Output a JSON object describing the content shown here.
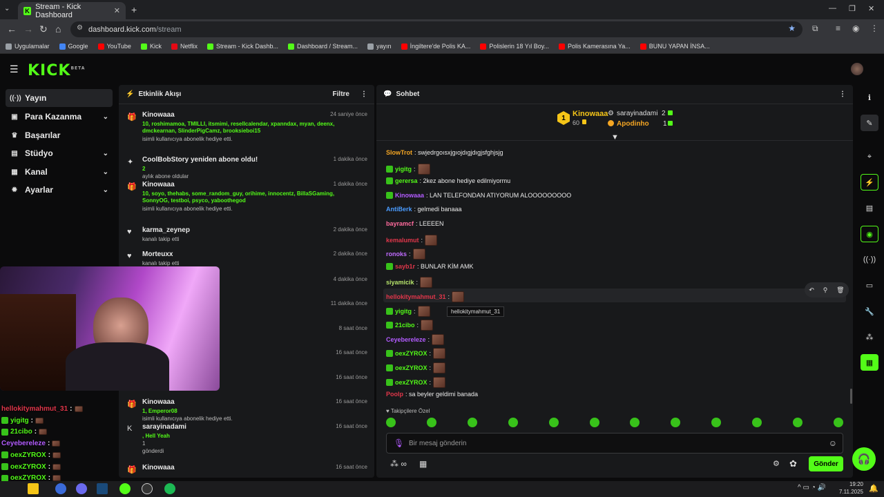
{
  "browser": {
    "tab_title": "Stream - Kick Dashboard",
    "url_host": "dashboard.kick.com",
    "url_path": "/stream",
    "bookmarks": [
      {
        "label": "Uygulamalar",
        "color": "#9aa0a6"
      },
      {
        "label": "Google",
        "color": "#4285f4"
      },
      {
        "label": "YouTube",
        "color": "#ff0000"
      },
      {
        "label": "Kick",
        "color": "#53fc18"
      },
      {
        "label": "Netflix",
        "color": "#e50914"
      },
      {
        "label": "Stream - Kick Dashb...",
        "color": "#53fc18"
      },
      {
        "label": "Dashboard / Stream...",
        "color": "#53fc18"
      },
      {
        "label": "yayın",
        "color": "#9aa0a6"
      },
      {
        "label": "İngiltere'de Polis KA...",
        "color": "#ff0000"
      },
      {
        "label": "Polislerin 18 Yıl Boy...",
        "color": "#ff0000"
      },
      {
        "label": "Polis Kamerasına Ya...",
        "color": "#ff0000"
      },
      {
        "label": "BUNU YAPAN İNSA...",
        "color": "#ff0000"
      }
    ]
  },
  "app": {
    "logo": "KICK",
    "logo_badge": "BETA",
    "accent": "#53fc18"
  },
  "nav": {
    "items": [
      {
        "label": "Yayın",
        "icon": "broadcast-icon",
        "glyph": "((·))"
      },
      {
        "label": "Para Kazanma",
        "icon": "money-icon",
        "glyph": "▣"
      },
      {
        "label": "Başarılar",
        "icon": "trophy-icon",
        "glyph": "♛"
      },
      {
        "label": "Stüdyo",
        "icon": "studio-icon",
        "glyph": "▤"
      },
      {
        "label": "Kanal",
        "icon": "channel-icon",
        "glyph": "▦"
      },
      {
        "label": "Ayarlar",
        "icon": "settings-icon",
        "glyph": "✹"
      }
    ]
  },
  "activity": {
    "title": "Etkinlik Akışı",
    "filter_label": "Filtre",
    "events": [
      {
        "who": "Kinowaaa",
        "when": "24 saniye önce",
        "line2": "10, roshimamoa, TMILLI, itsmimi, resellcalendar, xpanndax, myan, deenx, dmckearnan, SlinderPigCamz, brooksieboi15",
        "line3": "isimli kullanıcıya abonelik hediye etti.",
        "icon": "gift-icon",
        "glyph": "🎁"
      },
      {
        "who": "CoolBobStory yeniden abone oldu!",
        "when": "1 dakika önce",
        "line2": "2",
        "line3": "aylık abone oldular",
        "icon": "star-icon",
        "glyph": "✦"
      },
      {
        "who": "Kinowaaa",
        "when": "1 dakika önce",
        "line2": "10, soyo, thehabs, some_random_guy, orihime, innocentz, BillaSGaming, SonnyOG, testboi, psyco, yaboothegod",
        "line3": "isimli kullanıcıya abonelik hediye etti.",
        "icon": "gift-icon",
        "glyph": "🎁"
      },
      {
        "who": "karma_zeynep",
        "when": "2 dakika önce",
        "line2": "",
        "line3": "kanalı takip etti",
        "icon": "heart-icon",
        "glyph": "♥"
      },
      {
        "who": "Morteuxx",
        "when": "2 dakika önce",
        "line2": "",
        "line3": "kanalı takip etti",
        "icon": "heart-icon",
        "glyph": "♥"
      }
    ],
    "hidden_times": [
      "4 dakika önce",
      "11 dakika önce",
      "8 saat önce",
      "16 saat önce",
      "16 saat önce"
    ],
    "bottom_events": [
      {
        "who": "Kinowaaa",
        "when": "16 saat önce",
        "line2": "1, Emperor08",
        "line3": "isimli kullanıcıya abonelik hediye etti.",
        "icon": "gift-icon",
        "glyph": "🎁"
      },
      {
        "who": "sarayinadami",
        "when": "16 saat önce",
        "line2": ", Hell Yeah",
        "line3": "1",
        "line4": "gönderdi",
        "icon": "kick-icon",
        "glyph": "K"
      },
      {
        "who": "Kinowaaa",
        "when": "16 saat önce",
        "line2": "",
        "line3": "",
        "icon": "gift-icon",
        "glyph": "🎁"
      }
    ]
  },
  "chat": {
    "title": "Sohbet",
    "leaderboard": {
      "first_name": "Kinowaaa",
      "first_count": "60",
      "first_rank": "1",
      "second_name": "sarayinadami",
      "second_count": "2",
      "third_name": "Apodinho",
      "third_count": "1"
    },
    "messages": [
      {
        "user": "SlowTrot",
        "color": "#f5a623",
        "text": ": swjedrgoısxjgıojdıgjdıgjsfghjsjg",
        "emote": false
      },
      {
        "user": "yigitg",
        "color": "#53fc18",
        "text": ":",
        "emote": true
      },
      {
        "user": "gerersa",
        "color": "#53fc18",
        "text": ": 2kez abone hediye edilmiyormu",
        "emote": false
      },
      {
        "user": "Kinowaaa",
        "color": "#b35cff",
        "text": ": LAN TELEFONDAN ATIYORUM ALOOOOOOOOO",
        "emote": false
      },
      {
        "user": "AntiBerk",
        "color": "#4a9cff",
        "text": ": gelmedi banaaa",
        "emote": false
      },
      {
        "user": "bayramcf",
        "color": "#ff6b9d",
        "text": ": LEEEEN",
        "emote": false
      },
      {
        "user": "kemalumut",
        "color": "#e0364a",
        "text": ":",
        "emote": true
      },
      {
        "user": "ronoks",
        "color": "#c06bff",
        "text": ":",
        "emote": true
      },
      {
        "user": "sayb1r",
        "color": "#e0364a",
        "text": ": BUNLAR KİM AMK",
        "emote": false
      },
      {
        "user": "siyamicik",
        "color": "#b6e36b",
        "text": ":",
        "emote": true
      },
      {
        "user": "hellokitymahmut_31",
        "color": "#e0364a",
        "text": ":",
        "emote": true
      },
      {
        "user": "yigitg",
        "color": "#53fc18",
        "text": ":",
        "emote": true
      },
      {
        "user": "21cibo",
        "color": "#53fc18",
        "text": ":",
        "emote": true
      },
      {
        "user": "Ceyebereleze",
        "color": "#b35cff",
        "text": ":",
        "emote": true
      },
      {
        "user": "oexZYROX",
        "color": "#53fc18",
        "text": ":",
        "emote": true
      },
      {
        "user": "oexZYROX",
        "color": "#53fc18",
        "text": ":",
        "emote": true
      },
      {
        "user": "oexZYROX",
        "color": "#53fc18",
        "text": ":",
        "emote": true
      },
      {
        "user": "Poolp",
        "color": "#e0364a",
        "text": ": sa beyler geldimi banada",
        "emote": false
      }
    ],
    "tooltip": "hellokitymahmut_31",
    "followers_only": "Takipçilere Özel",
    "input_placeholder": "Bir mesaj gönderin",
    "send_label": "Gönder"
  },
  "overlay_chat": [
    {
      "user": "hellokitymahmut_31",
      "color": "#e0364a",
      "text": ":"
    },
    {
      "user": "yigitg",
      "color": "#53fc18",
      "text": ":"
    },
    {
      "user": "21cibo",
      "color": "#53fc18",
      "text": ":"
    },
    {
      "user": "Ceyebereleze",
      "color": "#b35cff",
      "text": ":"
    },
    {
      "user": "oexZYROX",
      "color": "#53fc18",
      "text": ":"
    },
    {
      "user": "oexZYROX",
      "color": "#53fc18",
      "text": ":"
    },
    {
      "user": "oexZYROX",
      "color": "#53fc18",
      "text": ":"
    },
    {
      "user": "Poolp",
      "color": "#e0364a",
      "text": ": sa beyler geldimi banada"
    }
  ],
  "taskbar": {
    "time": "19:20",
    "date": "7.11.2025"
  }
}
